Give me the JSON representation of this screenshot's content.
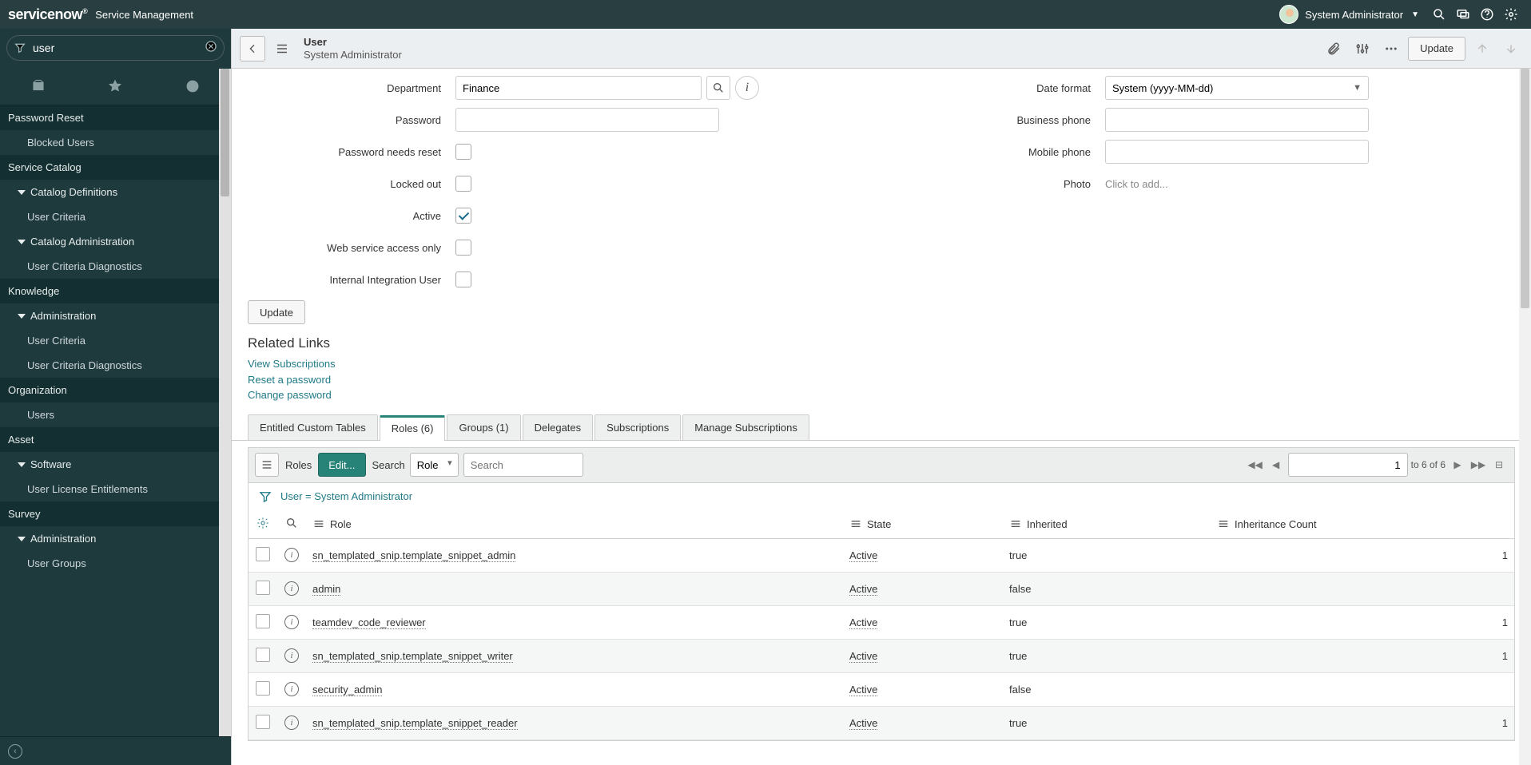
{
  "banner": {
    "logo": "servicenow",
    "product": "Service Management",
    "user_name": "System Administrator"
  },
  "nav": {
    "filter_value": "user",
    "sections": [
      {
        "type": "app",
        "label": "Password Reset"
      },
      {
        "type": "module",
        "label": "Blocked Users"
      },
      {
        "type": "app",
        "label": "Service Catalog"
      },
      {
        "type": "group",
        "label": "Catalog Definitions"
      },
      {
        "type": "module",
        "label": "User Criteria"
      },
      {
        "type": "group",
        "label": "Catalog Administration"
      },
      {
        "type": "module",
        "label": "User Criteria Diagnostics"
      },
      {
        "type": "app",
        "label": "Knowledge"
      },
      {
        "type": "group",
        "label": "Administration"
      },
      {
        "type": "module",
        "label": "User Criteria"
      },
      {
        "type": "module",
        "label": "User Criteria Diagnostics"
      },
      {
        "type": "app",
        "label": "Organization"
      },
      {
        "type": "module",
        "label": "Users"
      },
      {
        "type": "app",
        "label": "Asset"
      },
      {
        "type": "group",
        "label": "Software"
      },
      {
        "type": "module",
        "label": "User License Entitlements"
      },
      {
        "type": "app",
        "label": "Survey"
      },
      {
        "type": "group",
        "label": "Administration"
      },
      {
        "type": "module",
        "label": "User Groups"
      }
    ]
  },
  "form_header": {
    "table": "User",
    "display": "System Administrator",
    "update_btn": "Update"
  },
  "form": {
    "left": {
      "department_label": "Department",
      "department_value": "Finance",
      "password_label": "Password",
      "pneedsreset_label": "Password needs reset",
      "lockedout_label": "Locked out",
      "active_label": "Active",
      "webservice_label": "Web service access only",
      "intuser_label": "Internal Integration User"
    },
    "right": {
      "dateformat_label": "Date format",
      "dateformat_value": "System (yyyy-MM-dd)",
      "busphone_label": "Business phone",
      "mobphone_label": "Mobile phone",
      "photo_label": "Photo",
      "photo_value": "Click to add..."
    },
    "update_btn": "Update"
  },
  "related_links": {
    "heading": "Related Links",
    "links": [
      "View Subscriptions",
      "Reset a password",
      "Change password"
    ]
  },
  "tabs": [
    "Entitled Custom Tables",
    "Roles (6)",
    "Groups (1)",
    "Delegates",
    "Subscriptions",
    "Manage Subscriptions"
  ],
  "active_tab": 1,
  "list": {
    "title": "Roles",
    "edit_btn": "Edit...",
    "search_label": "Search",
    "search_field": "Role",
    "search_placeholder": "Search",
    "pager_page": "1",
    "pager_text": "to 6 of 6",
    "breadcrumb": "User = System Administrator",
    "columns": [
      "Role",
      "State",
      "Inherited",
      "Inheritance Count"
    ],
    "rows": [
      {
        "role": "sn_templated_snip.template_snippet_admin",
        "state": "Active",
        "inherited": "true",
        "count": "1"
      },
      {
        "role": "admin",
        "state": "Active",
        "inherited": "false",
        "count": ""
      },
      {
        "role": "teamdev_code_reviewer",
        "state": "Active",
        "inherited": "true",
        "count": "1"
      },
      {
        "role": "sn_templated_snip.template_snippet_writer",
        "state": "Active",
        "inherited": "true",
        "count": "1"
      },
      {
        "role": "security_admin",
        "state": "Active",
        "inherited": "false",
        "count": ""
      },
      {
        "role": "sn_templated_snip.template_snippet_reader",
        "state": "Active",
        "inherited": "true",
        "count": "1"
      }
    ]
  }
}
